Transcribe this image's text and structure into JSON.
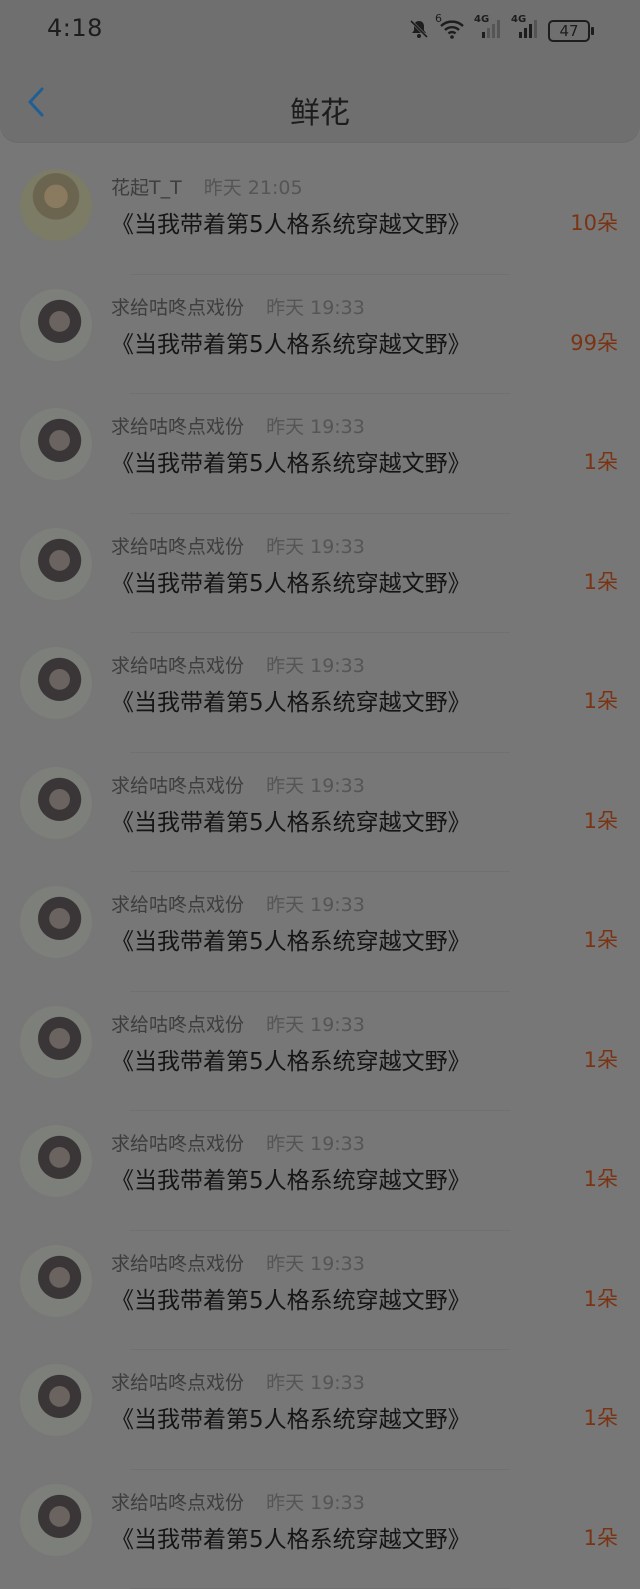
{
  "status": {
    "time": "4:18",
    "battery": "47",
    "signal_1": "4G",
    "signal_2": "4G",
    "wifi_badge": "6"
  },
  "header": {
    "title": "鲜花"
  },
  "items": [
    {
      "user": "花起T_T",
      "time": "昨天 21:05",
      "book": "《当我带着第5人格系统穿越文野》",
      "count": "10朵",
      "avatar": "a"
    },
    {
      "user": "求给咕咚点戏份",
      "time": "昨天 19:33",
      "book": "《当我带着第5人格系统穿越文野》",
      "count": "99朵",
      "avatar": "b"
    },
    {
      "user": "求给咕咚点戏份",
      "time": "昨天 19:33",
      "book": "《当我带着第5人格系统穿越文野》",
      "count": "1朵",
      "avatar": "b"
    },
    {
      "user": "求给咕咚点戏份",
      "time": "昨天 19:33",
      "book": "《当我带着第5人格系统穿越文野》",
      "count": "1朵",
      "avatar": "b"
    },
    {
      "user": "求给咕咚点戏份",
      "time": "昨天 19:33",
      "book": "《当我带着第5人格系统穿越文野》",
      "count": "1朵",
      "avatar": "b"
    },
    {
      "user": "求给咕咚点戏份",
      "time": "昨天 19:33",
      "book": "《当我带着第5人格系统穿越文野》",
      "count": "1朵",
      "avatar": "b"
    },
    {
      "user": "求给咕咚点戏份",
      "time": "昨天 19:33",
      "book": "《当我带着第5人格系统穿越文野》",
      "count": "1朵",
      "avatar": "b"
    },
    {
      "user": "求给咕咚点戏份",
      "time": "昨天 19:33",
      "book": "《当我带着第5人格系统穿越文野》",
      "count": "1朵",
      "avatar": "b"
    },
    {
      "user": "求给咕咚点戏份",
      "time": "昨天 19:33",
      "book": "《当我带着第5人格系统穿越文野》",
      "count": "1朵",
      "avatar": "b"
    },
    {
      "user": "求给咕咚点戏份",
      "time": "昨天 19:33",
      "book": "《当我带着第5人格系统穿越文野》",
      "count": "1朵",
      "avatar": "b"
    },
    {
      "user": "求给咕咚点戏份",
      "time": "昨天 19:33",
      "book": "《当我带着第5人格系统穿越文野》",
      "count": "1朵",
      "avatar": "b"
    },
    {
      "user": "求给咕咚点戏份",
      "time": "昨天 19:33",
      "book": "《当我带着第5人格系统穿越文野》",
      "count": "1朵",
      "avatar": "b"
    }
  ],
  "colors": {
    "accent": "#1f6fb0",
    "count": "#7a3414"
  },
  "icons": {
    "back": "chevron-left-icon",
    "mute": "bell-off-icon",
    "wifi": "wifi-icon",
    "signal": "cellular-signal-icon",
    "battery": "battery-icon"
  }
}
